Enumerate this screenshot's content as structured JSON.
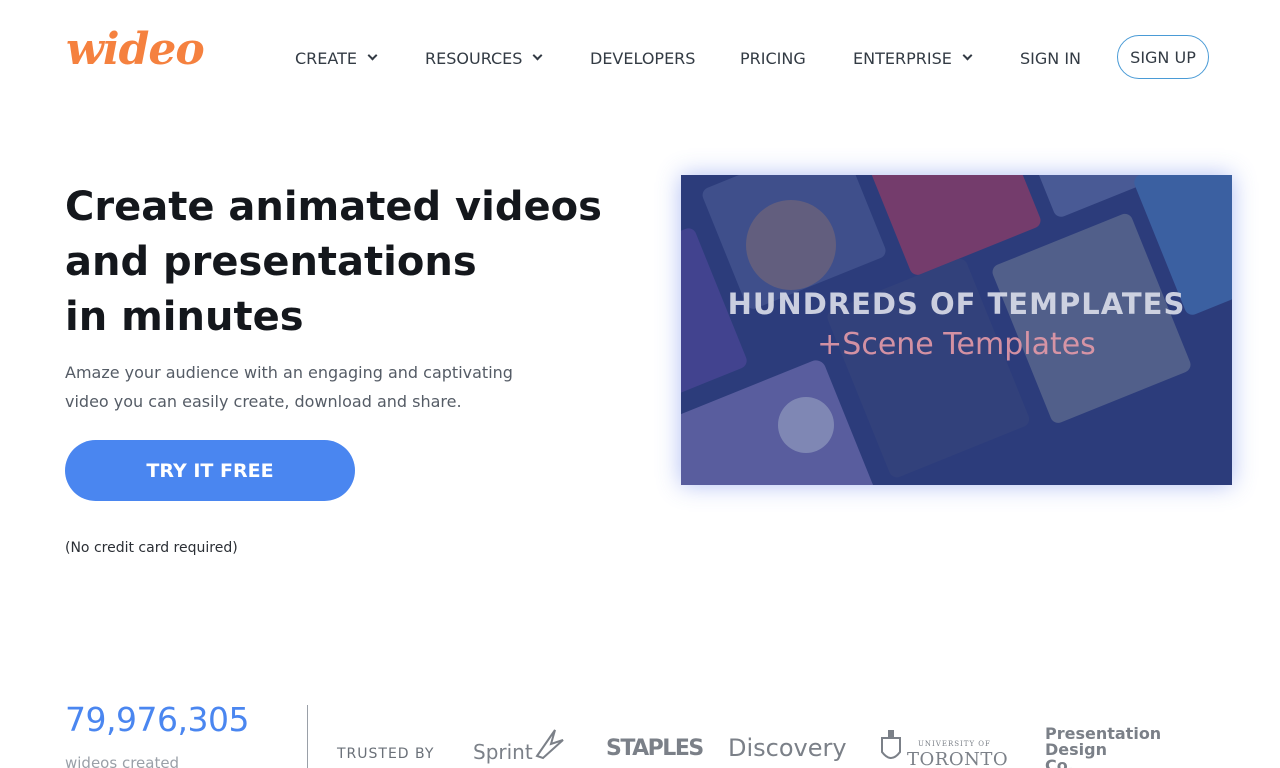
{
  "header": {
    "logo": "wideo",
    "nav": {
      "create": "CREATE",
      "resources": "RESOURCES",
      "developers": "DEVELOPERS",
      "pricing": "PRICING",
      "enterprise": "ENTERPRISE",
      "sign_in": "SIGN IN",
      "sign_up": "SIGN UP"
    }
  },
  "hero": {
    "title_lines": [
      "Create animated videos",
      "and presentations",
      "in minutes"
    ],
    "subtitle_lines": [
      "Amaze your audience with an engaging and captivating",
      "video you can easily create, download and share."
    ],
    "cta": "TRY IT FREE",
    "note": "(No credit card required)"
  },
  "video": {
    "line1": "HUNDREDS OF TEMPLATES",
    "line2": "+Scene Templates"
  },
  "stats": {
    "count": "79,976,305",
    "label": "wideos created",
    "trusted_by": "TRUSTED BY"
  },
  "logos": {
    "sprint": "Sprint",
    "staples": "STAPLES",
    "discovery": "Discovery",
    "toronto_top": "UNIVERSITY OF",
    "toronto": "TORONTO",
    "pdc_lines": [
      "Presentation",
      "Design",
      "Co."
    ]
  },
  "colors": {
    "brand_orange": "#f5813f",
    "accent_blue": "#4a86f0",
    "signup_border": "#4a9bd6"
  }
}
